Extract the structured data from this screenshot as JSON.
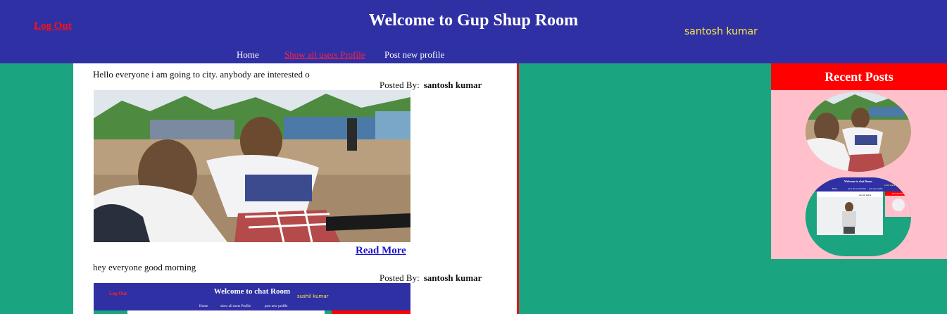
{
  "header": {
    "logout_label": "Log Out",
    "title": "Welcome to Gup Shup Room",
    "username": "santosh kumar"
  },
  "nav": {
    "home": "Home",
    "show_profiles": "Show all users Profile",
    "post_new": "Post new profile"
  },
  "posts": [
    {
      "text": "Hello everyone i am going to city. anybody are interested o",
      "posted_by_label": "Posted By:",
      "author": "santosh kumar",
      "read_more": "Read More"
    },
    {
      "text": "hey everyone good morning",
      "posted_by_label": "Posted By:",
      "author": "santosh kumar",
      "thumbnail": {
        "logout": "Log Out",
        "title": "Welcome to chat Room",
        "username": "sushil kumar",
        "nav_home": "Home",
        "nav_show": "show all users Profile",
        "nav_post": "post new profile"
      }
    }
  ],
  "sidebar": {
    "title": "Recent Posts",
    "thumb2": {
      "title": "Welcome to chat Room",
      "username": "sushil kumar",
      "nav_home": "Home",
      "nav_show": "show all users Profile",
      "nav_post": "post new profile",
      "recent": "Recent Posts",
      "poster": "santosh kumar"
    }
  },
  "colors": {
    "header_bg": "#3030a5",
    "page_bg": "#1aa480",
    "logout": "#ff1010",
    "username": "#ffeb3b",
    "nav_active": "#ff2040",
    "divider": "#e01515",
    "recent_head": "#ff0000",
    "recent_bg": "#ffc0cb",
    "link": "#1a14c8"
  }
}
